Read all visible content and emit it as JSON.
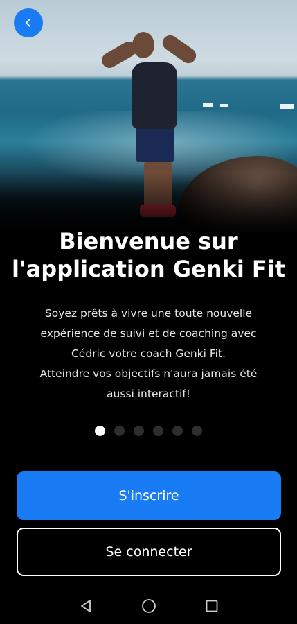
{
  "hero": {
    "scene": "photo-of-coach-flexing-by-the-sea"
  },
  "header": {
    "back_icon": "chevron-left-icon",
    "accent_color": "#1a7cf5"
  },
  "welcome": {
    "title_line1": "Bienvenue sur",
    "title_line2": "l'application Genki Fit",
    "description_lines": [
      "Soyez prêts à vivre une toute nouvelle",
      "expérience de suivi et de coaching avec",
      "Cédric votre coach Genki Fit.",
      "Atteindre vos objectifs n'aura jamais été",
      "aussi interactif!"
    ]
  },
  "pager": {
    "total": 6,
    "active_index": 0
  },
  "actions": {
    "signup_label": "S'inscrire",
    "login_label": "Se connecter"
  },
  "system_nav": {
    "back_icon": "triangle-back-icon",
    "home_icon": "circle-home-icon",
    "recents_icon": "square-recents-icon"
  }
}
